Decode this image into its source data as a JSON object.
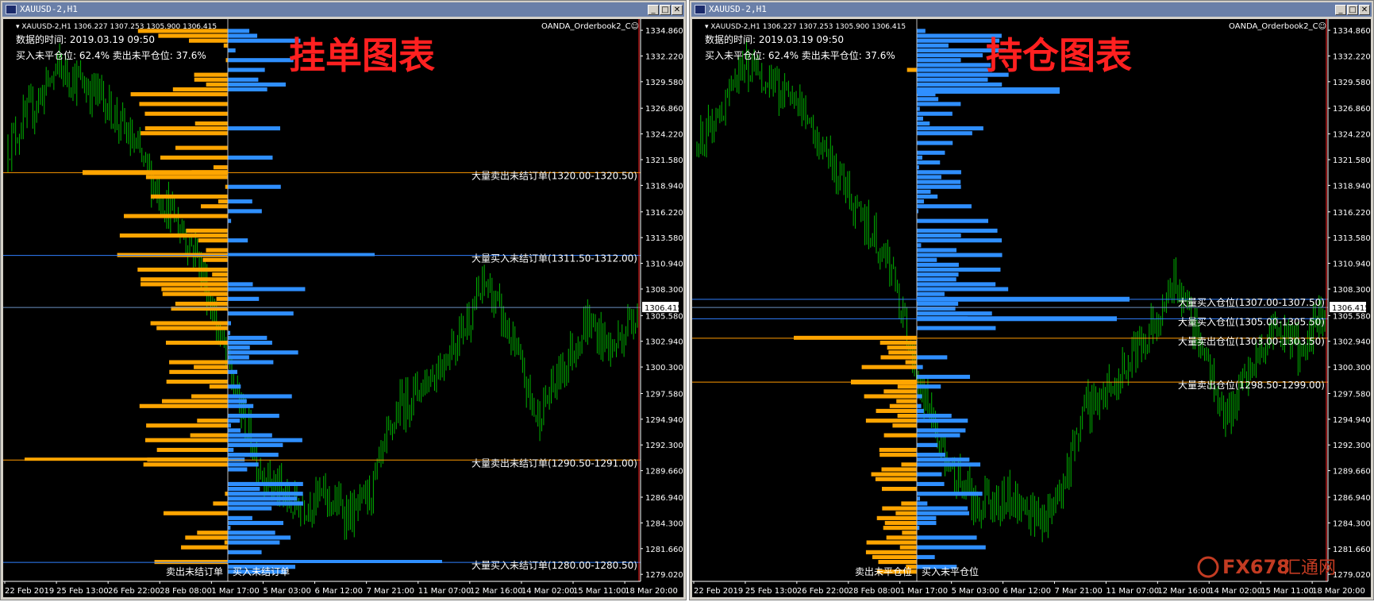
{
  "windows": [
    {
      "id": "left",
      "title": "XAUUSD-2,H1",
      "ohlc_label": "XAUUSD-2,H1  1306.227 1307.253 1305.900 1306.415",
      "indicator_label": "OANDA_Orderbook2_C☺",
      "info_time": "数据的时间: 2019.03.19 09:50",
      "info_ratio": "买入未平仓位: 62.4%  卖出未平仓位: 37.6%",
      "big_title": "挂单图表",
      "current_price": "1306.415",
      "bottom_left_label": "卖出未结订单",
      "bottom_right_label": "买入未结订单",
      "levels": [
        {
          "price": 1320.25,
          "color": "#ff9900",
          "label": "大量卖出未结订单(1320.00-1320.50)"
        },
        {
          "price": 1311.75,
          "color": "#2f7fff",
          "label": "大量买入未结订单(1311.50-1312.00)"
        },
        {
          "price": 1290.75,
          "color": "#ff9900",
          "label": "大量卖出未结订单(1290.50-1291.00)"
        },
        {
          "price": 1280.25,
          "color": "#2f7fff",
          "label": "大量买入未结订单(1280.00-1280.50)"
        }
      ]
    },
    {
      "id": "right",
      "title": "XAUUSD-2,H1",
      "ohlc_label": "XAUUSD-2,H1  1306.227 1307.253 1305.900 1306.415",
      "indicator_label": "OANDA_Orderbook2_C☺",
      "info_time": "数据的时间: 2019.03.19 09:50",
      "info_ratio": "买入未平仓位: 62.4%  卖出未平仓位: 37.6%",
      "big_title": "持仓图表",
      "current_price": "1306.415",
      "bottom_left_label": "卖出未平仓位",
      "bottom_right_label": "买入未平仓位",
      "levels": [
        {
          "price": 1307.25,
          "color": "#2f7fff",
          "label": "大量买入仓位(1307.00-1307.50)"
        },
        {
          "price": 1305.25,
          "color": "#2f7fff",
          "label": "大量买入仓位(1305.00-1305.50)"
        },
        {
          "price": 1303.25,
          "color": "#ff9900",
          "label": "大量卖出仓位(1303.00-1303.50)"
        },
        {
          "price": 1298.75,
          "color": "#ff9900",
          "label": "大量卖出仓位(1298.50-1299.00)"
        }
      ]
    }
  ],
  "price_axis": [
    "1334.860",
    "1332.220",
    "1329.580",
    "1326.860",
    "1324.220",
    "1321.580",
    "1318.940",
    "1316.220",
    "1313.580",
    "1310.940",
    "1308.300",
    "1305.580",
    "1302.940",
    "1300.300",
    "1297.580",
    "1294.940",
    "1292.300",
    "1289.660",
    "1286.940",
    "1284.300",
    "1281.660",
    "1279.020"
  ],
  "time_axis": [
    "22 Feb 2019",
    "25 Feb 13:00",
    "26 Feb 22:00",
    "28 Feb 08:00",
    "1 Mar 17:00",
    "5 Mar 03:00",
    "6 Mar 12:00",
    "7 Mar 21:00",
    "11 Mar 07:00",
    "12 Mar 16:00",
    "14 Mar 02:00",
    "15 Mar 11:00",
    "18 Mar 20:00"
  ],
  "watermark": {
    "brand": "FX678",
    "suffix": "汇通网"
  },
  "colors": {
    "candle": "#00b400",
    "buy": "#2f8fff",
    "sell": "#ffa500",
    "background": "#000000",
    "axis_text": "#ffffff",
    "title_red": "#ff2020"
  }
}
